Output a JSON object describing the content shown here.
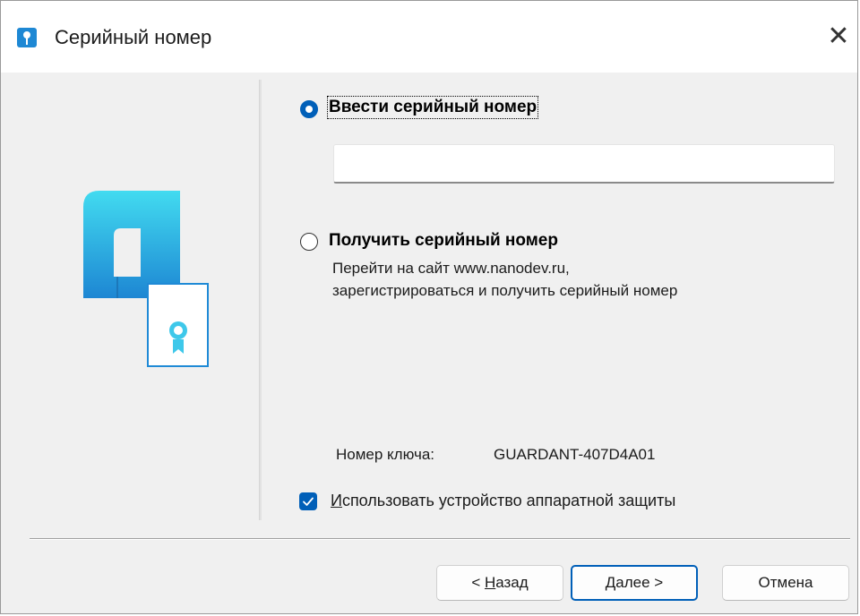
{
  "window": {
    "title": "Серийный номер"
  },
  "options": {
    "enter": {
      "label": "Ввести серийный номер",
      "selected": true,
      "input_value": ""
    },
    "get": {
      "label": "Получить серийный номер",
      "selected": false,
      "desc_line1": "Перейти на сайт www.nanodev.ru,",
      "desc_line2": "зарегистрироваться и получить серийный номер"
    }
  },
  "key": {
    "label": "Номер ключа:",
    "value": "GUARDANT-407D4A01"
  },
  "hardware_protection": {
    "checked": true,
    "label_mnemonic": "И",
    "label_rest": "спользовать устройство аппаратной защиты"
  },
  "buttons": {
    "back": {
      "prefix": "< ",
      "mnemonic": "Н",
      "rest": "азад"
    },
    "next": {
      "mnemonic": "Д",
      "rest": "алее >"
    },
    "cancel": "Отмена"
  },
  "colors": {
    "accent": "#005fb8",
    "logo_top": "#3fd7ef",
    "logo_bottom": "#1f8ad6"
  },
  "icons": [
    "app-key-icon",
    "close-icon",
    "nanocad-logo-icon",
    "certificate-icon",
    "checkmark-icon"
  ]
}
